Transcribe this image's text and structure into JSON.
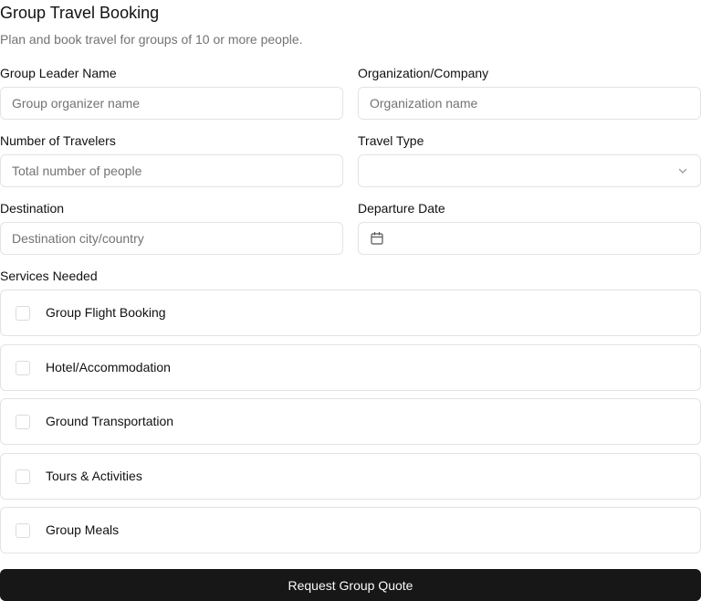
{
  "header": {
    "title": "Group Travel Booking",
    "subtitle": "Plan and book travel for groups of 10 or more people."
  },
  "fields": {
    "leader": {
      "label": "Group Leader Name",
      "placeholder": "Group organizer name",
      "value": ""
    },
    "organization": {
      "label": "Organization/Company",
      "placeholder": "Organization name",
      "value": ""
    },
    "travelers": {
      "label": "Number of Travelers",
      "placeholder": "Total number of people",
      "value": ""
    },
    "travel_type": {
      "label": "Travel Type",
      "value": "",
      "icon": "chevron-down-icon"
    },
    "destination": {
      "label": "Destination",
      "placeholder": "Destination city/country",
      "value": ""
    },
    "departure": {
      "label": "Departure Date",
      "value": "",
      "icon": "calendar-icon"
    }
  },
  "services": {
    "label": "Services Needed",
    "items": [
      {
        "label": "Group Flight Booking",
        "checked": false
      },
      {
        "label": "Hotel/Accommodation",
        "checked": false
      },
      {
        "label": "Ground Transportation",
        "checked": false
      },
      {
        "label": "Tours & Activities",
        "checked": false
      },
      {
        "label": "Group Meals",
        "checked": false
      }
    ]
  },
  "submit": {
    "label": "Request Group Quote"
  },
  "colors": {
    "border": "#e3e3e3",
    "placeholder": "#737373",
    "button_bg": "#171717",
    "button_text": "#fafafa"
  }
}
